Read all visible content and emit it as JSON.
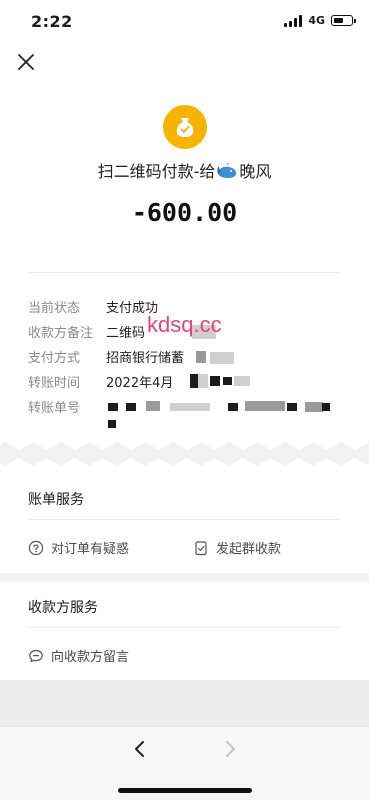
{
  "status_bar": {
    "time": "2:22",
    "network": "4G"
  },
  "header": {
    "close_icon": "close-icon"
  },
  "payment": {
    "merchant_icon": "money-bag-icon",
    "title_prefix": "扫二维码付款-给",
    "payee_name": "晚风",
    "amount": "-600.00"
  },
  "details": [
    {
      "label": "当前状态",
      "value": "支付成功"
    },
    {
      "label": "收款方备注",
      "value": "二维码"
    },
    {
      "label": "支付方式",
      "value": "招商银行储蓄"
    },
    {
      "label": "转账时间",
      "value": "2022年4月"
    },
    {
      "label": "转账单号",
      "value": ""
    }
  ],
  "watermark": "kdsq.cc",
  "bill_services": {
    "title": "账单服务",
    "actions": [
      {
        "label": "对订单有疑惑",
        "icon": "question-circle-icon"
      },
      {
        "label": "发起群收款",
        "icon": "checklist-icon"
      }
    ]
  },
  "payee_services": {
    "title": "收款方服务",
    "actions": [
      {
        "label": "向收款方留言",
        "icon": "message-icon"
      }
    ]
  },
  "colors": {
    "accent": "#f5b400",
    "watermark": "#e0457b",
    "label_gray": "#8a8a8a"
  }
}
